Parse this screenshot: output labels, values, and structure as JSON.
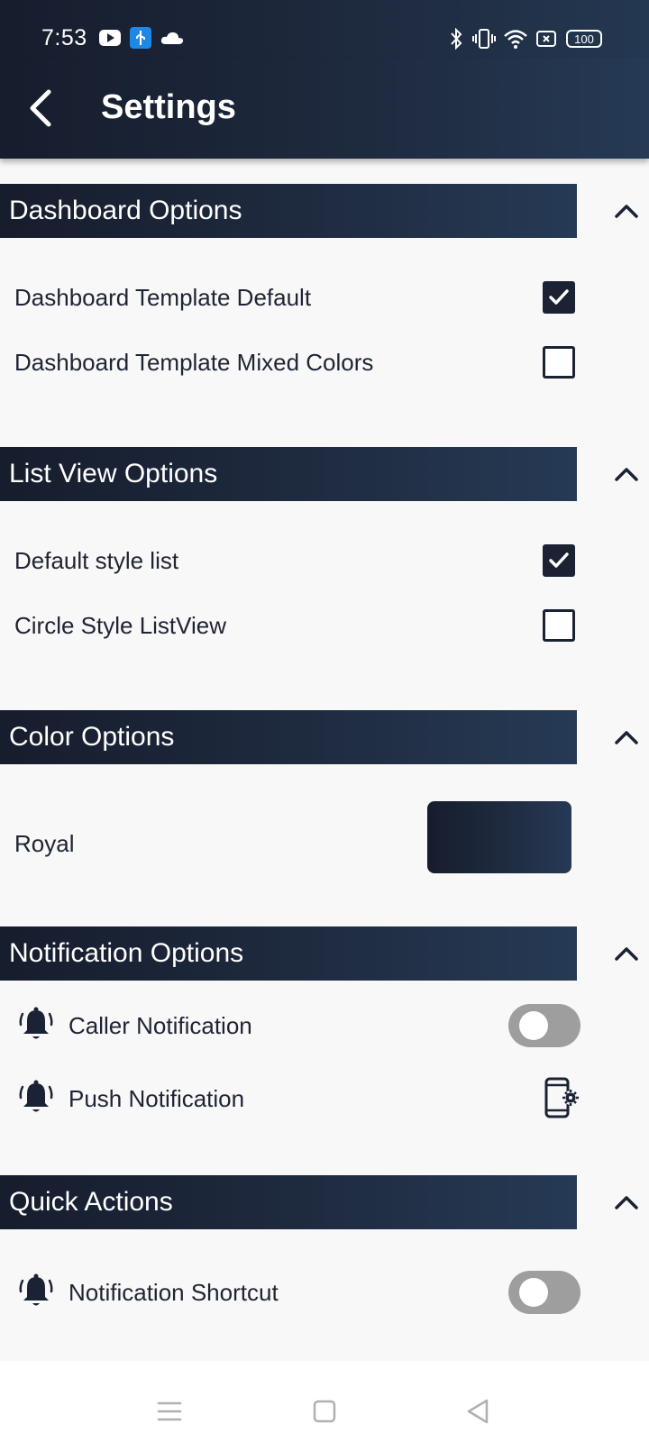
{
  "status_bar": {
    "time": "7:53",
    "battery": "100",
    "icons": [
      "youtube-icon",
      "usb-icon",
      "cloud-icon",
      "bluetooth-icon",
      "vibrate-icon",
      "wifi-icon",
      "screen-record-icon",
      "battery-icon"
    ]
  },
  "app_bar": {
    "title": "Settings",
    "back_icon": "arrow-back-icon"
  },
  "sections": {
    "dashboard": {
      "title": "Dashboard Options",
      "items": [
        {
          "label": "Dashboard Template Default",
          "checked": true
        },
        {
          "label": "Dashboard Template Mixed Colors",
          "checked": false
        }
      ]
    },
    "list_view": {
      "title": "List View Options",
      "items": [
        {
          "label": "Default style list",
          "checked": true
        },
        {
          "label": "Circle Style ListView",
          "checked": false
        }
      ]
    },
    "color": {
      "title": "Color Options",
      "item": {
        "label": "Royal",
        "swatch_colors": [
          "#161d2d",
          "#263a55"
        ]
      }
    },
    "notification": {
      "title": "Notification Options",
      "items": [
        {
          "label": "Caller Notification",
          "icon": "bell-icon",
          "control": "toggle",
          "on": false
        },
        {
          "label": "Push Notification",
          "icon": "bell-icon",
          "control": "phone-settings-icon"
        }
      ]
    },
    "quick_actions": {
      "title": "Quick Actions",
      "items": [
        {
          "label": "Notification Shortcut",
          "icon": "bell-icon",
          "control": "toggle",
          "on": false
        }
      ]
    }
  },
  "nav_bar": {
    "buttons": [
      "menu-icon",
      "home-square-icon",
      "back-triangle-icon"
    ]
  },
  "colors": {
    "primary_dark": "#161d2d",
    "primary_light": "#263a55",
    "background": "#f8f8f8",
    "toggle_off": "#9e9e9e"
  }
}
